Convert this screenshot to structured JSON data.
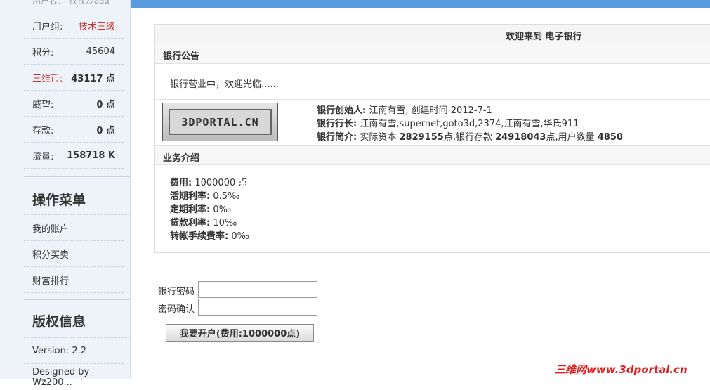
{
  "sidebar": {
    "cut_row": "用户名：   孜孜沙aaa",
    "stats": [
      {
        "label": "用户组:",
        "value": "技术三级"
      },
      {
        "label": "积分:",
        "value": "45604"
      },
      {
        "label": "三维币:",
        "value": "43117 点"
      },
      {
        "label": "威望:",
        "value": "0 点"
      },
      {
        "label": "存款:",
        "value": "0 点"
      },
      {
        "label": "流量:",
        "value": "158718 K"
      }
    ],
    "menu_title": "操作菜单",
    "menu_items": [
      "我的账户",
      "积分买卖",
      "财富排行"
    ],
    "copyright_title": "版权信息",
    "version": "Version: 2.2",
    "designed_by": "Designed by Wz200..."
  },
  "main": {
    "header_title": "欢迎来到 电子银行",
    "notice_title": "银行公告",
    "notice_text": "银行营业中，欢迎光临......",
    "logo_text": "3DPORTAL.CN",
    "founder_label": "银行创始人:",
    "founder_value": "江南有雪, 创建时间 2012-7-1",
    "president_label": "银行行长:",
    "president_value": "江南有雪,supernet,goto3d,2374,江南有雪,华氏911",
    "intro_label": "银行简介:",
    "intro_p1": "实际资本",
    "intro_v1": "2829155",
    "intro_p2": "点,银行存款",
    "intro_v2": "24918043",
    "intro_p3": "点,用户数量",
    "intro_v3": "4850",
    "biz_title": "业务介绍",
    "biz_items": [
      {
        "label": "费用:",
        "value": "1000000 点"
      },
      {
        "label": "活期利率:",
        "value": "0.5‰"
      },
      {
        "label": "定期利率:",
        "value": "0‰"
      },
      {
        "label": "贷款利率:",
        "value": "10‰"
      },
      {
        "label": "转帐手续费率:",
        "value": "0‰"
      }
    ]
  },
  "form": {
    "password_label": "银行密码",
    "confirm_label": "密码确认",
    "submit_label": "我要开户(费用:1000000点)"
  },
  "watermark": "三维网www.3dportal.cn",
  "colors": {
    "accent_blue": "#5a9be0",
    "red": "#c8332f",
    "sidebar_bg": "#eef3fa"
  }
}
